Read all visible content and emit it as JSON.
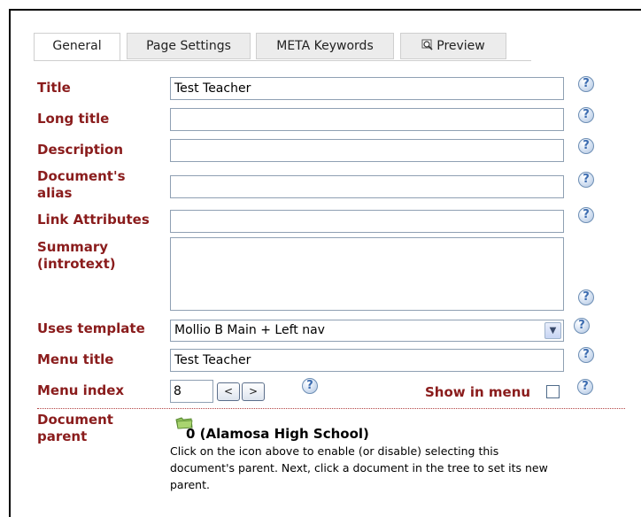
{
  "tabs": [
    {
      "label": "General",
      "active": true
    },
    {
      "label": "Page Settings",
      "active": false
    },
    {
      "label": "META Keywords",
      "active": false
    },
    {
      "label": "Preview",
      "active": false,
      "icon": "magnifier-icon"
    }
  ],
  "fields": {
    "title": {
      "label": "Title",
      "value": "Test Teacher"
    },
    "long_title": {
      "label": "Long title",
      "value": ""
    },
    "description": {
      "label": "Description",
      "value": ""
    },
    "alias": {
      "label_line1": "Document's",
      "label_line2": "alias",
      "value": ""
    },
    "link_attributes": {
      "label": "Link Attributes",
      "value": ""
    },
    "summary": {
      "label_line1": "Summary",
      "label_line2": "(introtext)",
      "value": ""
    },
    "template": {
      "label": "Uses template",
      "selected": "Mollio B Main + Left nav"
    },
    "menu_title": {
      "label": "Menu title",
      "value": "Test Teacher"
    },
    "menu_index": {
      "label": "Menu index",
      "value": "8",
      "prev": "<",
      "next": ">"
    },
    "show_in_menu": {
      "label": "Show in menu",
      "checked": false
    },
    "parent": {
      "label_line1": "Document",
      "label_line2": "parent",
      "value": "0 (Alamosa High School)",
      "help_text": "Click on the icon above to enable (or disable) selecting this document's parent. Next, click a document in the tree to set its new parent."
    }
  },
  "help_glyph": "?",
  "select_arrow": "▼",
  "colors": {
    "label": "#8a1c1c",
    "field_border": "#8fa0b3",
    "help_icon": "#3c6cb0",
    "folder": "#7fb04f"
  }
}
